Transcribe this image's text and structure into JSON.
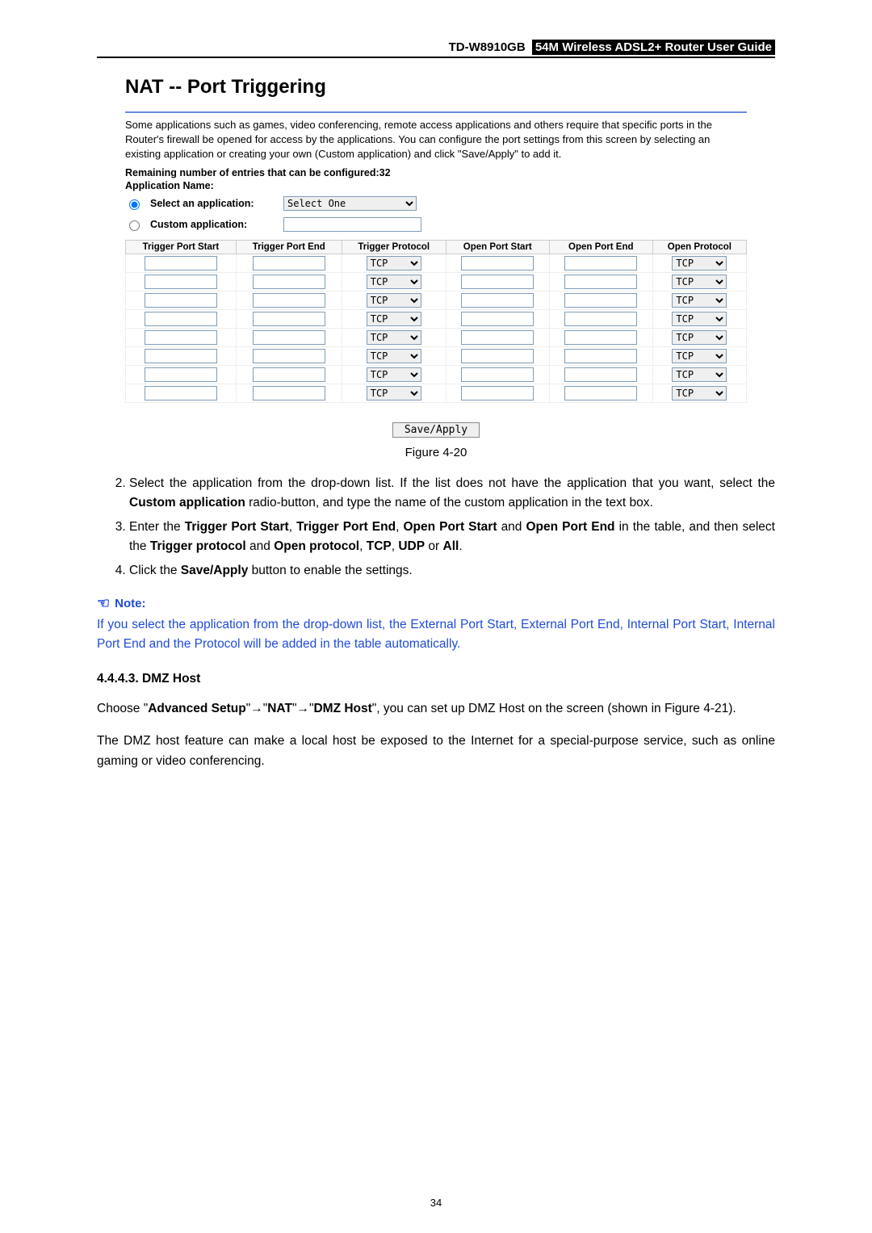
{
  "header": {
    "model": "TD-W8910GB",
    "subtitle": "54M Wireless ADSL2+ Router User Guide"
  },
  "router_panel": {
    "title": "NAT -- Port Triggering",
    "description": "Some applications such as games, video conferencing, remote access applications and others require that specific ports in the Router's firewall be opened for access by the applications. You can configure the port settings from this screen by selecting an existing application or creating your own (Custom application) and click \"Save/Apply\" to add it.",
    "remaining": "Remaining number of entries that can be configured:32",
    "application_name_label": "Application Name:",
    "radio_select_label": "Select an application:",
    "radio_custom_label": "Custom application:",
    "select_default": "Select One",
    "table_headers": [
      "Trigger Port Start",
      "Trigger Port End",
      "Trigger Protocol",
      "Open Port Start",
      "Open Port End",
      "Open Protocol"
    ],
    "protocol_default": "TCP",
    "row_count": 8,
    "save_button": "Save/Apply"
  },
  "figure_caption": "Figure 4-20",
  "steps": {
    "s2_pre": "Select the application from the drop-down list. If the list does not have the application that you want, select the ",
    "s2_bold": "Custom application",
    "s2_post": " radio-button, and type the name of the custom application in the text box.",
    "s3_a": "Enter the ",
    "s3_b1": "Trigger Port Start",
    "s3_c": ", ",
    "s3_b2": "Trigger Port End",
    "s3_b3": "Open Port Start",
    "s3_d": " and ",
    "s3_b4": "Open Port End",
    "s3_e": " in the table, and then select the ",
    "s3_b5": "Trigger protocol",
    "s3_b6": "Open protocol",
    "s3_b7": "TCP",
    "s3_b8": "UDP",
    "s3_f": " or ",
    "s3_b9": "All",
    "s3_g": ".",
    "s4_a": "Click the ",
    "s4_b": "Save/Apply",
    "s4_c": " button to enable the settings."
  },
  "note": {
    "label": "Note:",
    "body": "If you select the application from the drop-down list, the External Port Start, External Port End, Internal Port Start, Internal Port End and the Protocol will be added in the table automatically."
  },
  "section": {
    "heading": "4.4.4.3.  DMZ Host",
    "p1_a": "Choose \"",
    "p1_b1": "Advanced Setup",
    "p1_arrow": "→",
    "p1_q": "\"",
    "p1_b2": "NAT",
    "p1_b3": "DMZ Host",
    "p1_c": "\", you can set up DMZ Host on the screen (shown in Figure 4-21).",
    "p2": "The DMZ host feature can make a local host be exposed to the Internet for a special-purpose service, such as online gaming or video conferencing."
  },
  "page_number": "34"
}
